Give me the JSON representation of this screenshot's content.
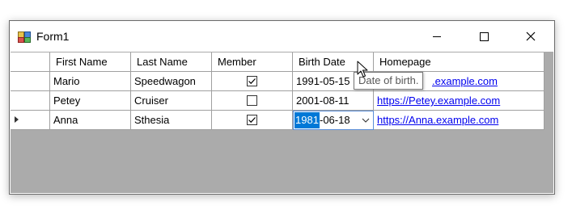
{
  "window": {
    "title": "Form1",
    "controls": {
      "minimize": "minimize",
      "maximize": "maximize",
      "close": "close"
    }
  },
  "grid": {
    "columns": [
      "First Name",
      "Last Name",
      "Member",
      "Birth Date",
      "Homepage"
    ],
    "rows": [
      {
        "first": "Mario",
        "last": "Speedwagon",
        "member": true,
        "birth": "1991-05-15",
        "homepage": ".example.com"
      },
      {
        "first": "Petey",
        "last": "Cruiser",
        "member": false,
        "birth": "2001-08-11",
        "homepage": "https://Petey.example.com"
      },
      {
        "first": "Anna",
        "last": "Sthesia",
        "member": true,
        "birth": "1981-06-18",
        "homepage": "https://Anna.example.com"
      }
    ],
    "editor": {
      "year_selected": "1981",
      "rest": "-06-18"
    },
    "current_row_indicator": "current-row-arrow"
  },
  "tooltip": {
    "text": "Date of birth."
  },
  "colors": {
    "grid_background": "#ababab",
    "link": "#0000ee",
    "selection": "#0078d7",
    "editor_border": "#5b8ed7"
  }
}
